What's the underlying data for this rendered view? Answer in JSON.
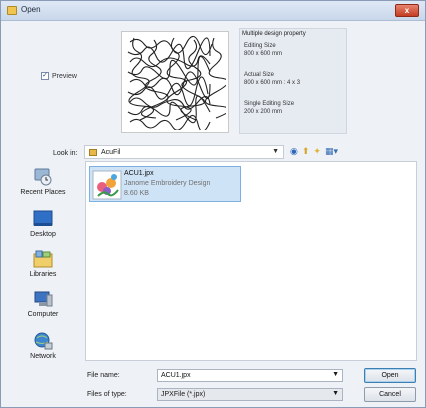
{
  "window": {
    "title": "Open",
    "close_label": "x"
  },
  "preview": {
    "checkbox_checked": true,
    "checkbox_label": "Preview"
  },
  "property": {
    "title": "Multiple design property",
    "editing_size_label": "Editing Size",
    "editing_size_value": "800 x 600 mm",
    "actual_size_label": "Actual Size",
    "actual_size_value": "800 x 600 mm : 4 x 3",
    "single_editing_label": "Single Editing Size",
    "single_editing_value": "200 x 200 mm"
  },
  "lookin": {
    "label": "Look in:",
    "value": "AcuFil",
    "icons": [
      "back-icon",
      "up-folder-icon",
      "new-folder-icon",
      "view-menu-icon"
    ]
  },
  "places": [
    {
      "label": "Recent Places",
      "icon": "recent-places-icon"
    },
    {
      "label": "Desktop",
      "icon": "desktop-icon"
    },
    {
      "label": "Libraries",
      "icon": "libraries-icon"
    },
    {
      "label": "Computer",
      "icon": "computer-icon"
    },
    {
      "label": "Network",
      "icon": "network-icon"
    }
  ],
  "files": [
    {
      "name": "ACU1.jpx",
      "type": "Janome Embroidery Design",
      "size": "8.60 KB",
      "selected": true
    }
  ],
  "filename": {
    "label": "File name:",
    "value": "ACU1.jpx"
  },
  "filetype": {
    "label": "Files of type:",
    "value": "JPXFile (*.jpx)"
  },
  "buttons": {
    "open": "Open",
    "cancel": "Cancel"
  }
}
